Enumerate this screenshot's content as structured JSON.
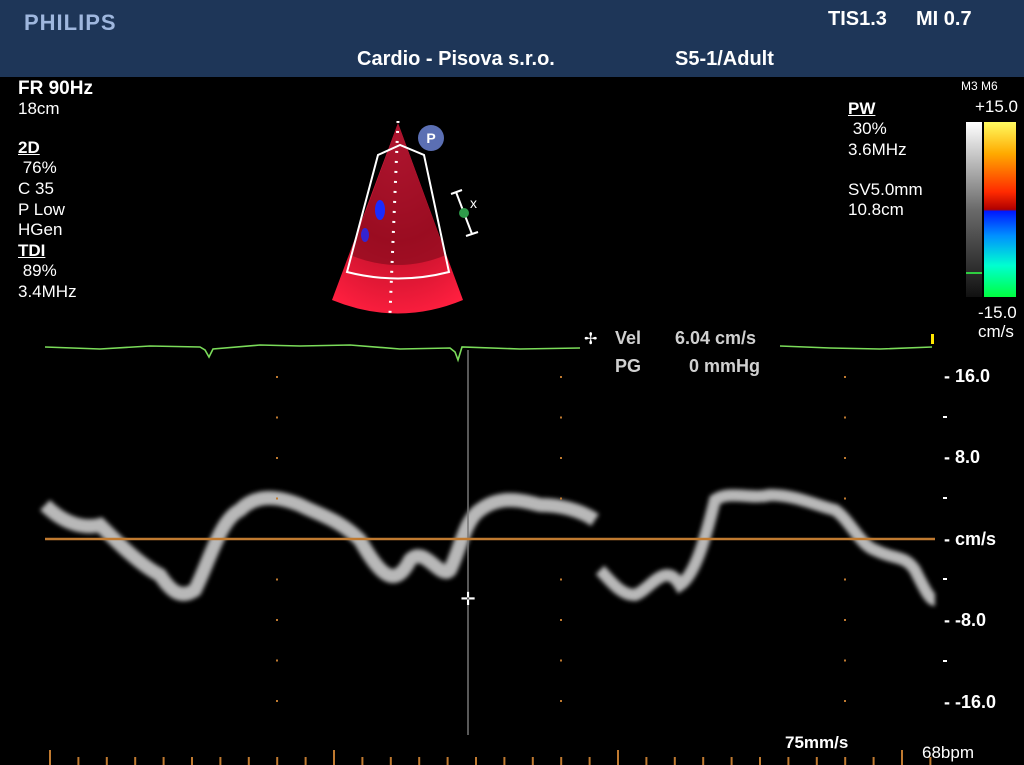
{
  "header": {
    "brand": "PHILIPS",
    "tis": "TIS1.3",
    "mi": "MI 0.7",
    "institution": "Cardio - Pisova s.r.o.",
    "probe": "S5-1/Adult"
  },
  "left_panel": {
    "fr": "FR 90Hz",
    "depth": "18cm",
    "mode_2d": "2D",
    "gain_2d": " 76%",
    "compression": "C 35",
    "persistence": "P Low",
    "gen": "HGen",
    "mode_tdi": "TDI",
    "gain_tdi": " 89%",
    "freq_tdi": "3.4MHz"
  },
  "right_panel": {
    "mode_pw": "PW",
    "gain_pw": " 30%",
    "freq_pw": "3.6MHz",
    "sample_volume": "SV5.0mm",
    "sv_depth": "10.8cm"
  },
  "colorbar": {
    "map": "M3 M6",
    "max": "+15.0",
    "min": "-15.0",
    "unit": "cm/s"
  },
  "measurement": {
    "vel_label": "Vel",
    "vel_value": "6.04 cm/s",
    "pg_label": "PG",
    "pg_value": "0 mmHg"
  },
  "scale": {
    "ticks": [
      "16.0",
      "8.0",
      "cm/s",
      "-8.0",
      "-16.0"
    ]
  },
  "footer": {
    "sweep": "75mm/s",
    "heart_rate": "68bpm"
  },
  "probe_marker": "P",
  "colors": {
    "header_bg": "#1e3658",
    "ecg": "#7bdc5a",
    "baseline": "#c07a30",
    "ticks": "#c07a30"
  }
}
